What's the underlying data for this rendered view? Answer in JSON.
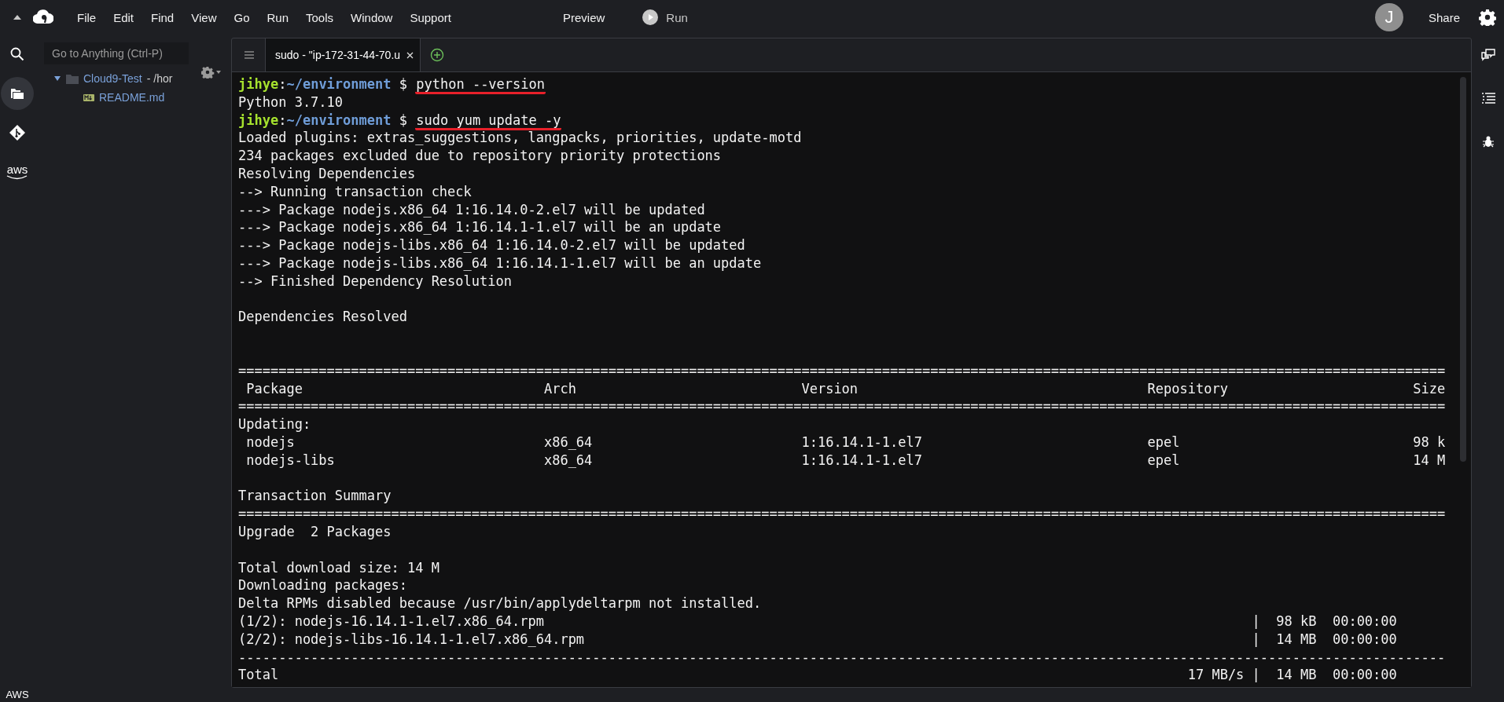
{
  "menu_bar": {
    "items": [
      "File",
      "Edit",
      "Find",
      "View",
      "Go",
      "Run",
      "Tools",
      "Window",
      "Support"
    ],
    "preview": "Preview",
    "run": "Run",
    "avatar": "J",
    "share": "Share"
  },
  "left_bar": {
    "items": [
      {
        "kind": "search",
        "selected": false
      },
      {
        "kind": "files",
        "selected": true
      },
      {
        "kind": "git",
        "selected": false
      },
      {
        "kind": "aws",
        "label": "aws",
        "selected": false
      }
    ],
    "footer": "AWS"
  },
  "file_panel": {
    "search": {
      "placeholder": "Go to Anything (Ctrl-P)"
    },
    "tree": [
      {
        "name": "Cloud9-Test",
        "path": " - /hor",
        "kind": "folder",
        "expanded": true,
        "children": [
          {
            "name": "README.md",
            "kind": "markdown"
          }
        ]
      }
    ]
  },
  "tabs": [
    {
      "label": "sudo - \"ip-172-31-44-70.u",
      "selected": true
    }
  ],
  "terminal": {
    "lines": [
      {
        "kind": "prompt",
        "user": "jihye",
        "separator": ":",
        "path": "~/environment",
        "symbol": "$",
        "command": "python --version",
        "underlined": true
      },
      {
        "kind": "text",
        "text": "Python 3.7.10"
      },
      {
        "kind": "prompt",
        "user": "jihye",
        "separator": ":",
        "path": "~/environment",
        "symbol": "$",
        "command": "sudo yum update -y",
        "underlined": true
      },
      {
        "kind": "text",
        "text": "Loaded plugins: extras_suggestions, langpacks, priorities, update-motd"
      },
      {
        "kind": "text",
        "text": "234 packages excluded due to repository priority protections"
      },
      {
        "kind": "text",
        "text": "Resolving Dependencies"
      },
      {
        "kind": "text",
        "text": "--> Running transaction check"
      },
      {
        "kind": "text",
        "text": "---> Package nodejs.x86_64 1:16.14.0-2.el7 will be updated"
      },
      {
        "kind": "text",
        "text": "---> Package nodejs.x86_64 1:16.14.1-1.el7 will be an update"
      },
      {
        "kind": "text",
        "text": "---> Package nodejs-libs.x86_64 1:16.14.0-2.el7 will be updated"
      },
      {
        "kind": "text",
        "text": "---> Package nodejs-libs.x86_64 1:16.14.1-1.el7 will be an update"
      },
      {
        "kind": "text",
        "text": "--> Finished Dependency Resolution"
      },
      {
        "kind": "blank"
      },
      {
        "kind": "text",
        "text": "Dependencies Resolved"
      },
      {
        "kind": "blank"
      },
      {
        "kind": "blank"
      },
      {
        "kind": "rule",
        "text": "======================================================================================================================================================"
      },
      {
        "kind": "row",
        "cells": [
          "Package",
          "Arch",
          "Version",
          "Repository",
          "Size"
        ]
      },
      {
        "kind": "rule",
        "text": "======================================================================================================================================================"
      },
      {
        "kind": "text",
        "text": "Updating:"
      },
      {
        "kind": "row",
        "cells": [
          "nodejs",
          "x86_64",
          "1:16.14.1-1.el7",
          "epel",
          "98 k"
        ]
      },
      {
        "kind": "row",
        "cells": [
          "nodejs-libs",
          "x86_64",
          "1:16.14.1-1.el7",
          "epel",
          "14 M"
        ]
      },
      {
        "kind": "blank"
      },
      {
        "kind": "text",
        "text": "Transaction Summary"
      },
      {
        "kind": "rule",
        "text": "======================================================================================================================================================"
      },
      {
        "kind": "text",
        "text": "Upgrade  2 Packages"
      },
      {
        "kind": "blank"
      },
      {
        "kind": "text",
        "text": "Total download size: 14 M"
      },
      {
        "kind": "text",
        "text": "Downloading packages:"
      },
      {
        "kind": "text",
        "text": "Delta RPMs disabled because /usr/bin/applydeltarpm not installed."
      },
      {
        "kind": "download",
        "left": "(1/2): nodejs-16.14.1-1.el7.x86_64.rpm",
        "right": "|  98 kB  00:00:00"
      },
      {
        "kind": "download",
        "left": "(2/2): nodejs-libs-16.14.1-1.el7.x86_64.rpm",
        "right": "|  14 MB  00:00:00"
      },
      {
        "kind": "rule",
        "text": "------------------------------------------------------------------------------------------------------------------------------------------------------"
      },
      {
        "kind": "download",
        "left": "Total",
        "right": "17 MB/s |  14 MB  00:00:00"
      }
    ]
  }
}
